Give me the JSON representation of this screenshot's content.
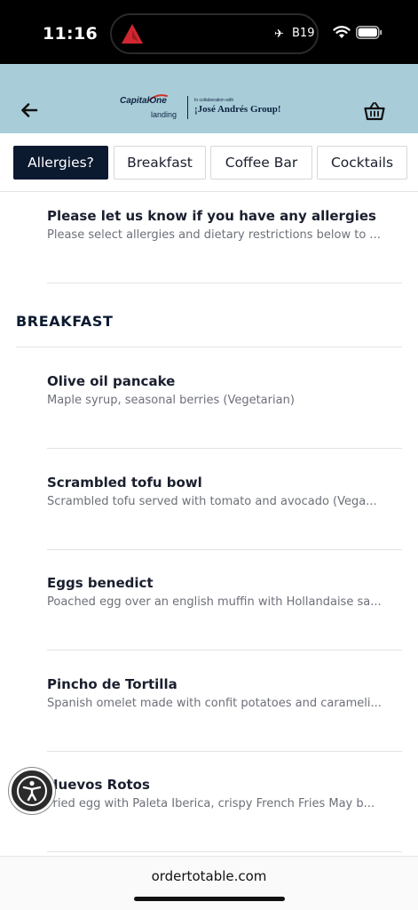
{
  "status_bar": {
    "time": "11:16",
    "flight_gate": "B19",
    "icons": [
      "delta-logo-icon",
      "airplane-icon",
      "wifi-icon",
      "battery-icon"
    ]
  },
  "header": {
    "brand_primary": "CapitalOne",
    "brand_secondary": "landing",
    "collab_text": "In collaboration with",
    "partner_name": "¡José Andrés Group!",
    "icons": [
      "back-arrow-icon",
      "basket-icon"
    ]
  },
  "tabs": [
    {
      "label": "Allergies?",
      "active": true
    },
    {
      "label": "Breakfast",
      "active": false
    },
    {
      "label": "Coffee Bar",
      "active": false
    },
    {
      "label": "Cocktails",
      "active": false
    }
  ],
  "allergy_notice": {
    "title": "Please let us know if you have any allergies",
    "description": "Please select allergies and dietary restrictions below to ..."
  },
  "section": {
    "heading": "BREAKFAST"
  },
  "items": [
    {
      "name": "Olive oil pancake",
      "description": "Maple syrup, seasonal berries (Vegetarian)"
    },
    {
      "name": "Scrambled tofu bowl",
      "description": "Scrambled tofu served with tomato and avocado (Vega..."
    },
    {
      "name": "Eggs benedict",
      "description": "Poached egg over an english muffin with Hollandaise sa..."
    },
    {
      "name": "Pincho de Tortilla",
      "description": "Spanish omelet made with confit potatoes and carameli..."
    },
    {
      "name": "Huevos Rotos",
      "description": "Fried egg with Paleta Iberica, crispy French Fries May b..."
    }
  ],
  "url_bar": {
    "url": "ordertotable.com"
  },
  "colors": {
    "header_bg": "#a9cdd8",
    "active_tab_bg": "#0c1a30",
    "text_primary": "#1a1f2e",
    "text_secondary": "#6d7079"
  }
}
